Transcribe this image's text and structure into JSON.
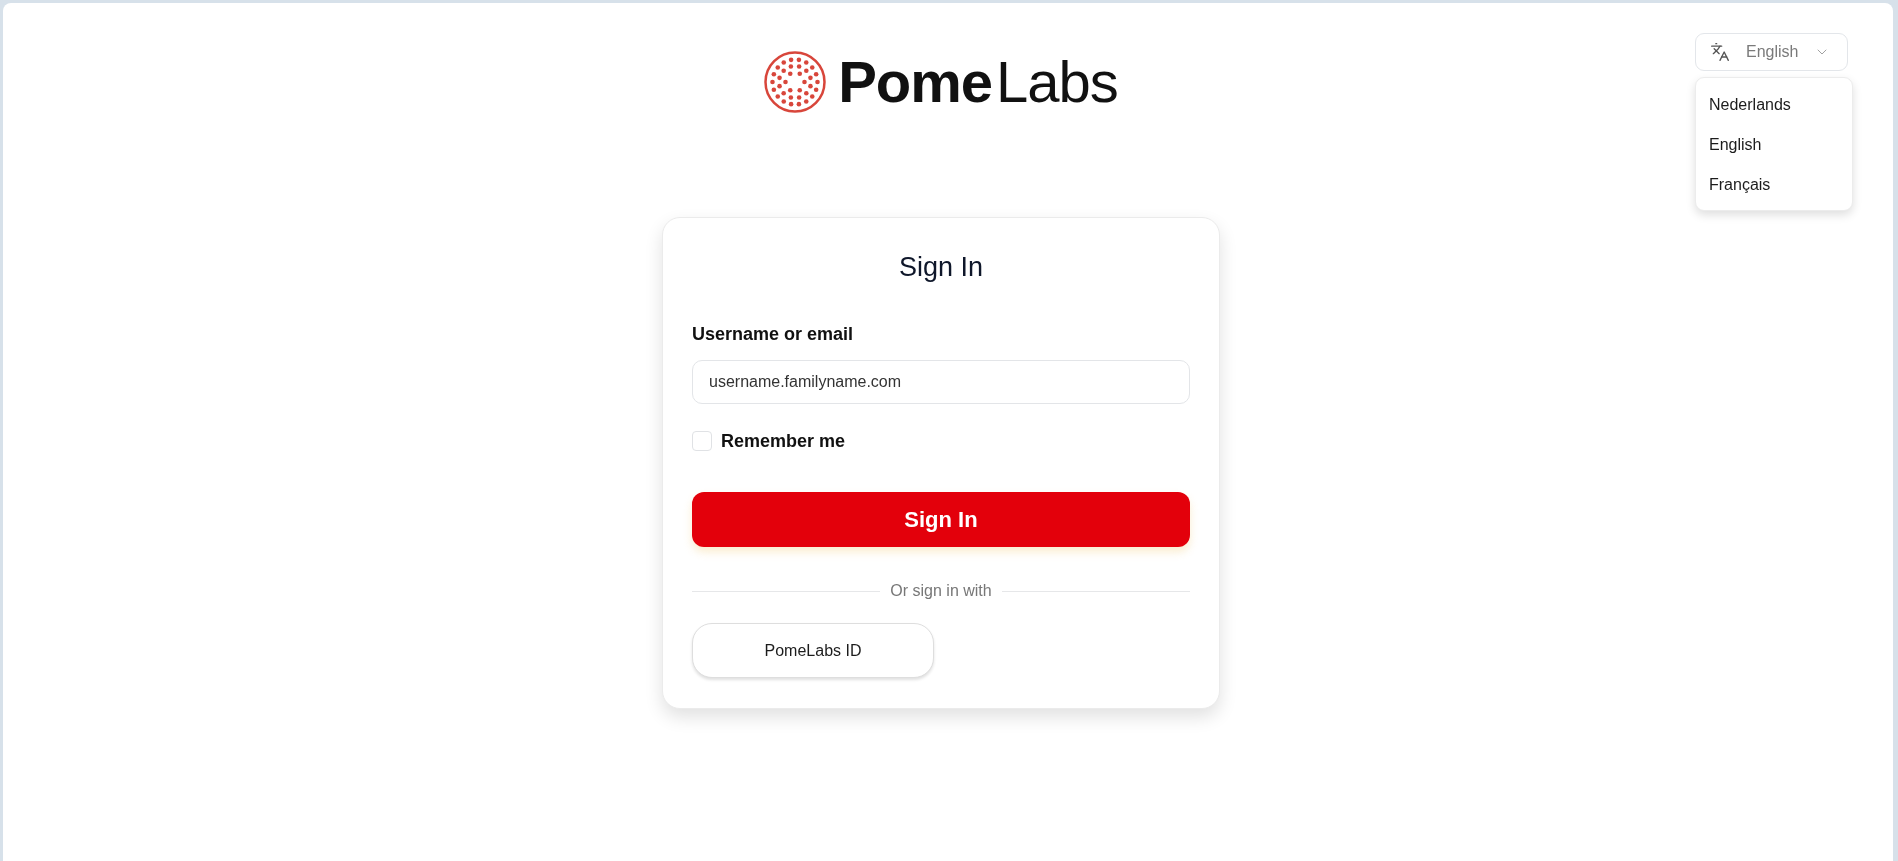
{
  "header": {
    "logo": {
      "text": "**Pome**Labs"
    },
    "language_selector": {
      "value": "English",
      "expanded": true,
      "options": [
        "Nederlands",
        "English",
        "Français"
      ]
    }
  },
  "card": {
    "title": "Sign In",
    "username_field": {
      "label": "Username or email",
      "value": "username.familyname.com"
    },
    "remember_me": {
      "label": "Remember me",
      "checked": false
    },
    "submit_button": "Sign In",
    "divider": "Or sign in with",
    "providers": [
      {
        "label": "PomeLabs ID"
      }
    ]
  }
}
